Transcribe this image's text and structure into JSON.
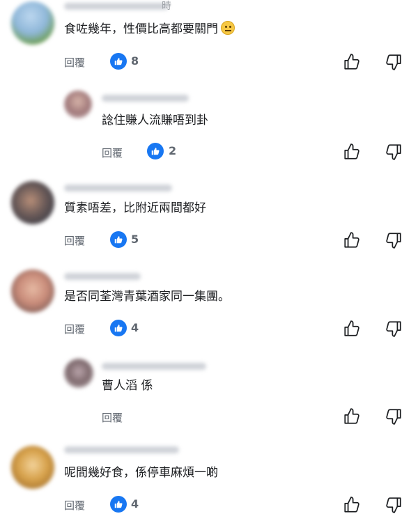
{
  "comments": [
    {
      "text": "食咗幾年，性價比高都要關門",
      "reply_label": "回覆",
      "likes": "8",
      "has_emoji": true,
      "emoji": "face-with-raised-eyebrow"
    },
    {
      "text": "諗住賺人流賺唔到卦",
      "reply_label": "回覆",
      "likes": "2"
    },
    {
      "text": "質素唔差，比附近兩間都好",
      "reply_label": "回覆",
      "likes": "5"
    },
    {
      "text": "是否同荃灣青葉酒家同一集團。",
      "reply_label": "回覆",
      "likes": "4"
    },
    {
      "text": "曹人滔 係",
      "reply_label": "回覆",
      "likes": ""
    },
    {
      "text": "呢間幾好食，係停車麻煩一啲",
      "reply_label": "回覆",
      "likes": "4"
    }
  ],
  "partial_header_glyph": "時",
  "colors": {
    "like_badge": "#1877f2",
    "meta_text": "#606770",
    "text": "#1c1e21"
  },
  "icons": {
    "like": "thumbs-up-icon",
    "dislike": "thumbs-down-icon",
    "reaction": "like-reaction-icon"
  }
}
